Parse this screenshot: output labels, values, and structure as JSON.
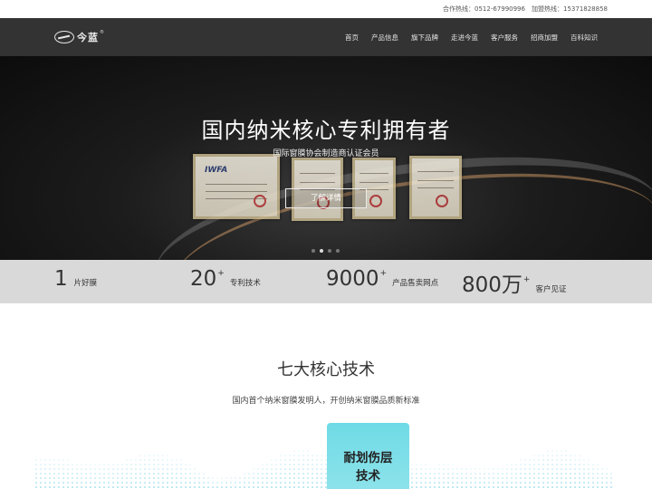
{
  "topbar": {
    "cooperation": "合作热线：0512-67990996",
    "franchise": "加盟热线：15371828858"
  },
  "header": {
    "logo_text": "今蓝",
    "logo_reg": "®",
    "nav": [
      "首页",
      "产品信息",
      "旗下品牌",
      "走进今蓝",
      "客户服务",
      "招商加盟",
      "百科知识"
    ]
  },
  "hero": {
    "title": "国内纳米核心专利拥有者",
    "subtitle": "国际窗膜协会制造商认证会员",
    "button": "了解详情",
    "cert_logo": "IWFA",
    "slide_count": 4,
    "active_slide": 2
  },
  "stats": [
    {
      "number": "1",
      "sup": "",
      "label": "片好膜"
    },
    {
      "number": "20",
      "sup": "+",
      "label": "专利技术"
    },
    {
      "number": "9000",
      "sup": "+",
      "label": "产品售卖网点"
    },
    {
      "number": "800万",
      "sup": "+",
      "label": "客户见证"
    }
  ],
  "core": {
    "title": "七大核心技术",
    "subtitle": "国内首个纳米窗膜发明人，开创纳米窗膜品质新标准",
    "card_line1": "耐划伤层",
    "card_line2": "技术"
  },
  "colors": {
    "header_bg": "#333333",
    "stats_bg": "#d9d9d9",
    "card_accent": "#6fdbe6"
  }
}
